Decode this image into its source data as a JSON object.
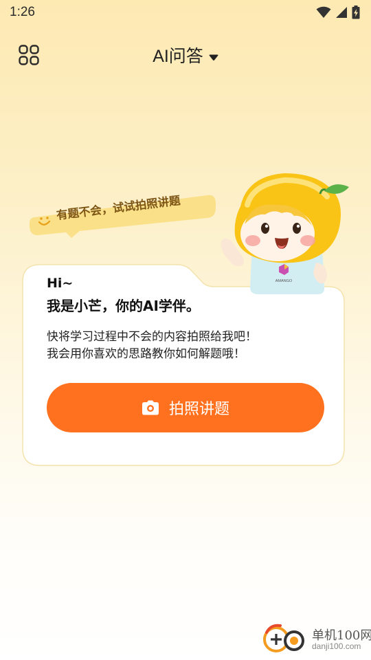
{
  "status_bar": {
    "time": "1:26"
  },
  "header": {
    "title": "AI问答"
  },
  "speech_bubble": {
    "text": "有题不会，试试拍照讲题"
  },
  "mascot": {
    "badge_text": "AMANGO"
  },
  "card": {
    "greeting": "Hi~",
    "intro": "我是小芒，你的AI学伴。",
    "desc_line1": "快将学习过程中不会的内容拍照给我吧！",
    "desc_line2": "我会用你喜欢的思路教你如何解题哦！",
    "button_label": "拍照讲题"
  },
  "watermark": {
    "name": "单机100网",
    "domain": "danji100.com"
  },
  "colors": {
    "accent": "#ff711f",
    "bubble": "#fbe08a",
    "bubble_text": "#7d5616",
    "mascot_yellow": "#f9c416"
  }
}
